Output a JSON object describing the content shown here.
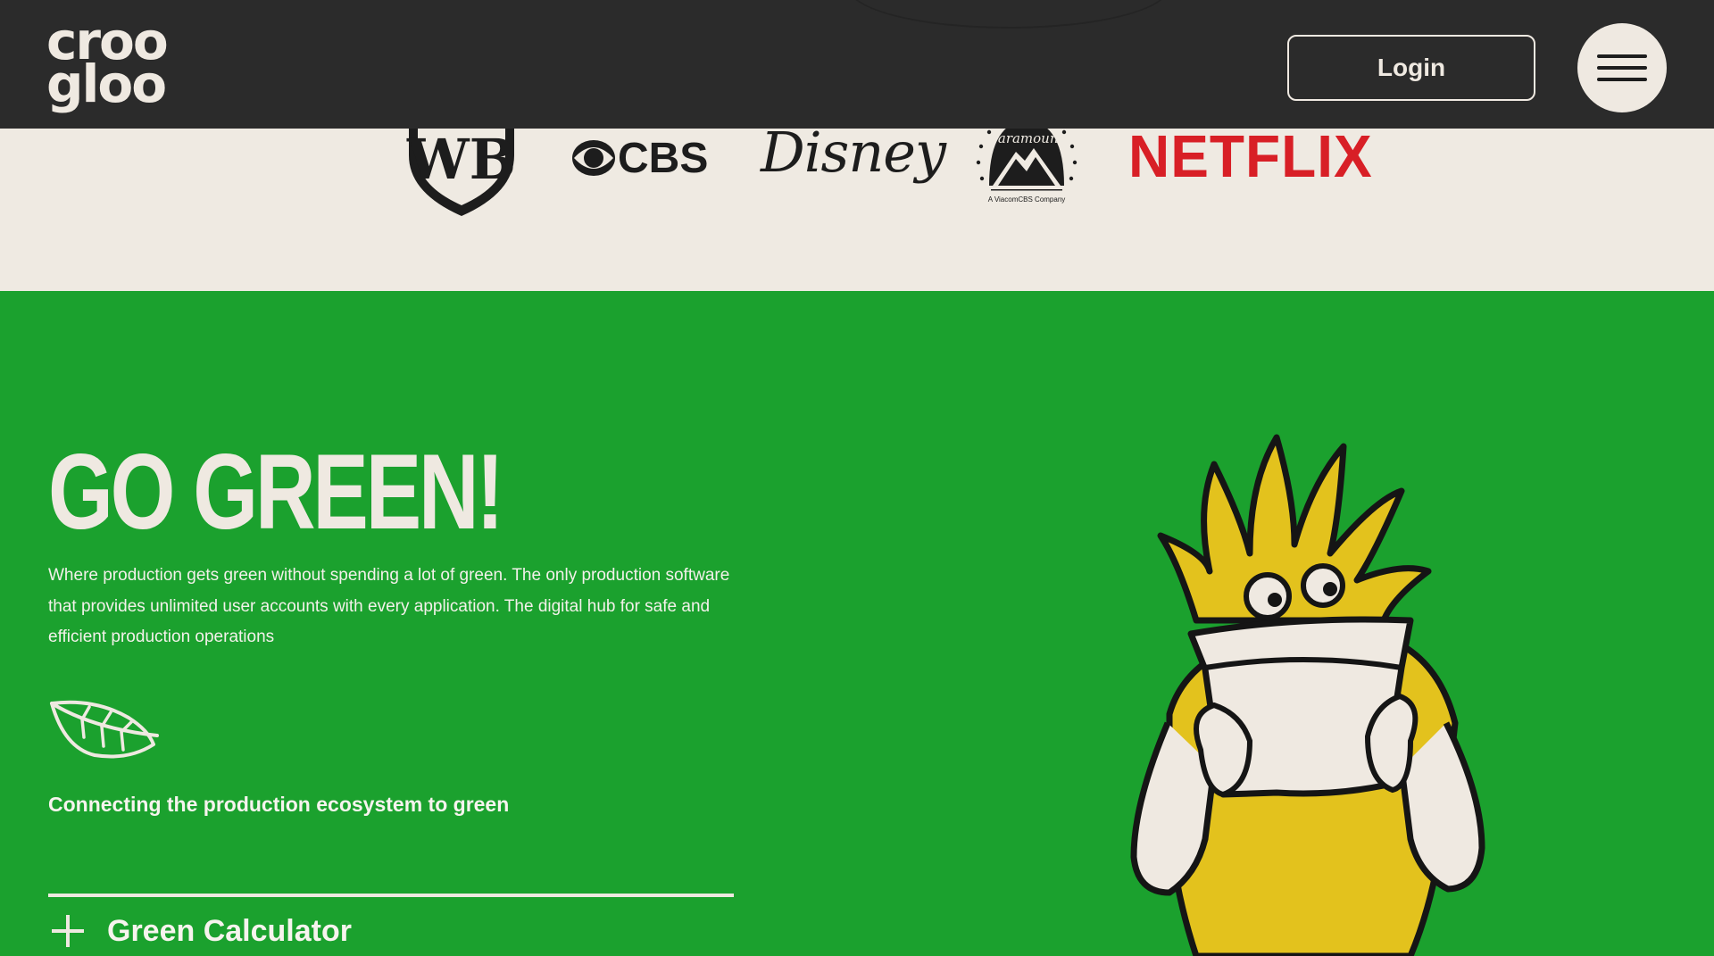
{
  "header": {
    "logo_line1": "croo",
    "logo_line2": "gloo",
    "login_label": "Login",
    "menu_icon": "hamburger-icon"
  },
  "brands": {
    "wb": "WB",
    "cbs": "CBS",
    "disney": "Disney",
    "paramount_name": "Paramount",
    "paramount_sub": "A ViacomCBS Company",
    "netflix": "NETFLIX"
  },
  "hero": {
    "title": "GO GREEN!",
    "description": "Where production gets green without spending a lot of green. The only production software that provides unlimited user accounts with every application. The digital hub for safe and efficient production operations",
    "feature_icon": "leaf-icon",
    "feature_label": "Connecting the production ecosystem to green",
    "accordion_label": "Green Calculator"
  },
  "colors": {
    "header_bg": "#2b2b2b",
    "cream": "#efe9e1",
    "green": "#1ba12e",
    "netflix_red": "#d81f26",
    "mascot_yellow": "#e3c21d"
  }
}
